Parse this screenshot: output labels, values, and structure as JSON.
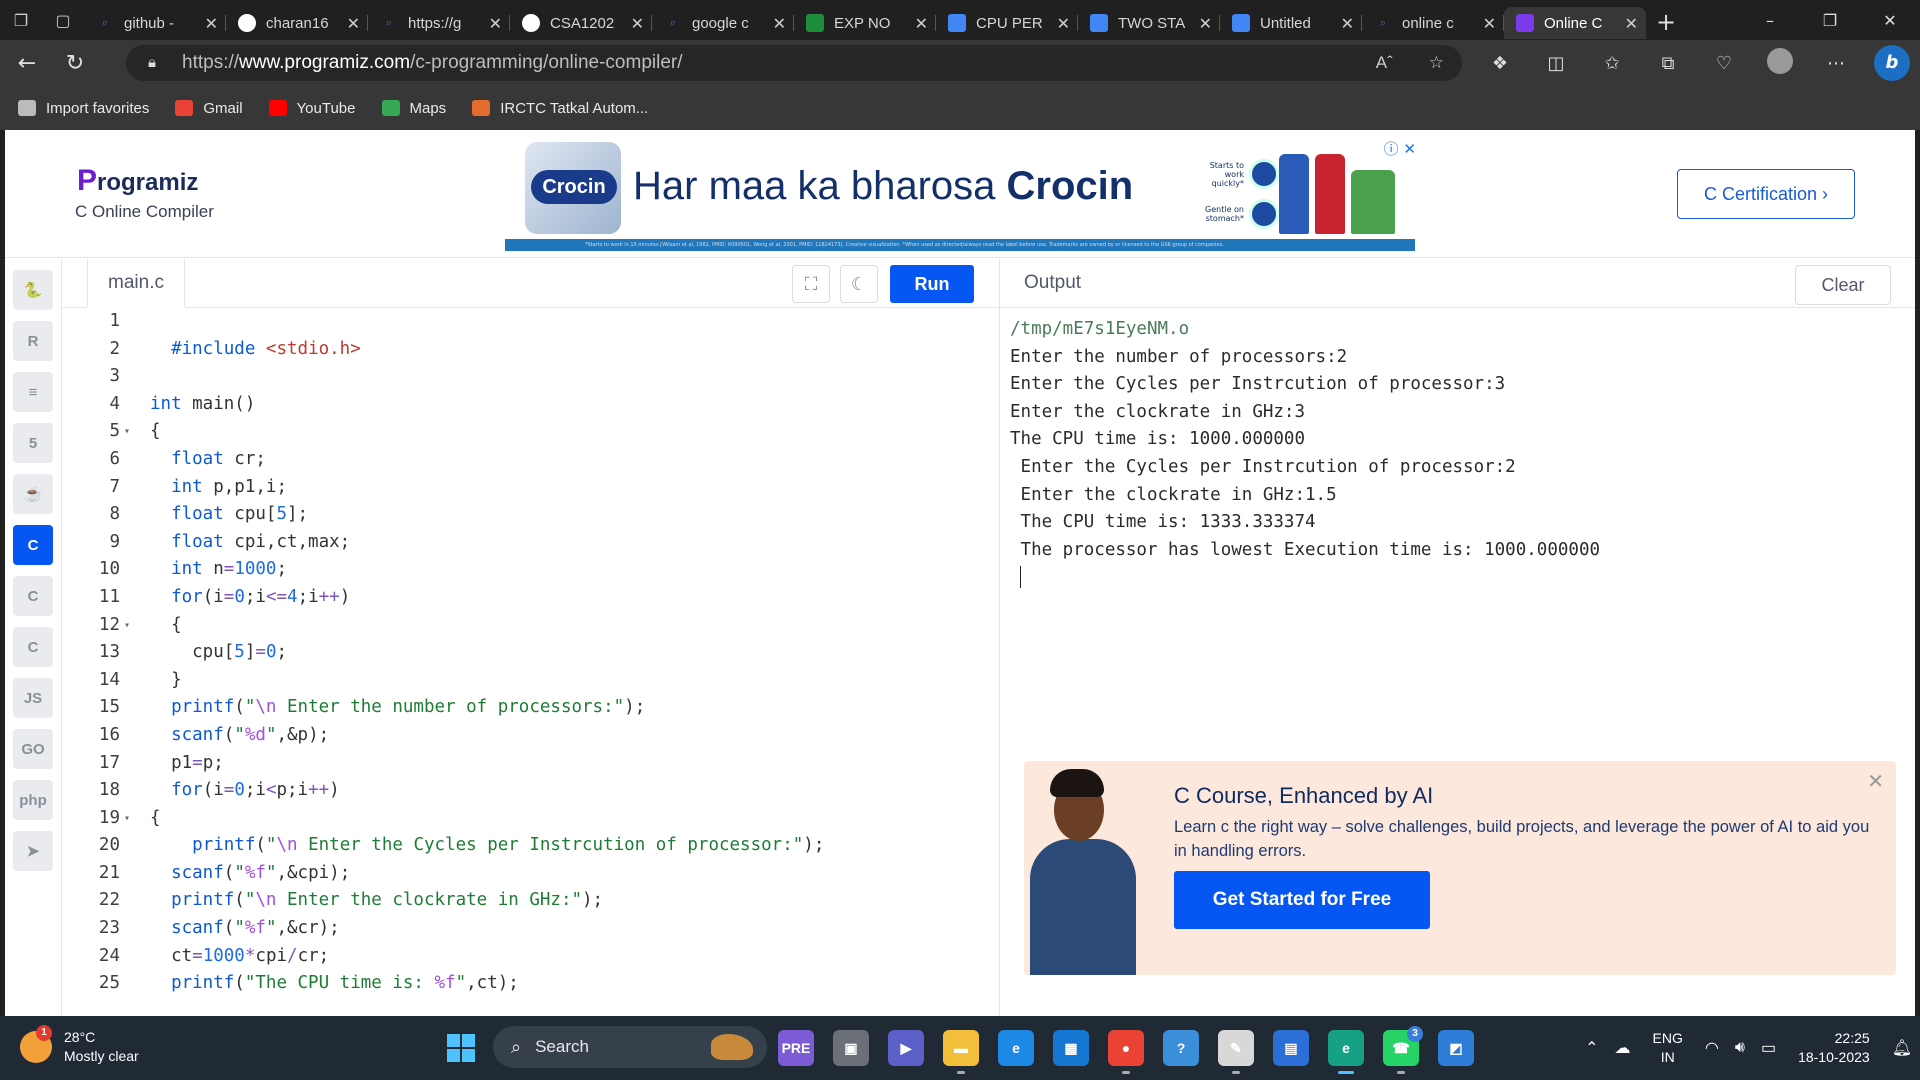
{
  "browser": {
    "tabs": [
      {
        "label": "github -",
        "icon": "search-icon",
        "color": "#3b6fd8"
      },
      {
        "label": "charan16",
        "icon": "github-icon",
        "color": "#ffffff"
      },
      {
        "label": "https://g",
        "icon": "search-icon",
        "color": "#3b6fd8"
      },
      {
        "label": "CSA1202",
        "icon": "github-icon",
        "color": "#ffffff"
      },
      {
        "label": "google c",
        "icon": "search-icon",
        "color": "#3b6fd8"
      },
      {
        "label": "EXP NO",
        "icon": "classroom-icon",
        "color": "#1e8e3e"
      },
      {
        "label": "CPU PER",
        "icon": "docs-icon",
        "color": "#4285f4"
      },
      {
        "label": "TWO STA",
        "icon": "docs-icon",
        "color": "#4285f4"
      },
      {
        "label": "Untitled",
        "icon": "docs-icon",
        "color": "#4285f4"
      },
      {
        "label": "online c",
        "icon": "search-icon",
        "color": "#3b6fd8"
      },
      {
        "label": "Online C",
        "icon": "programiz-icon",
        "color": "#7c3aed",
        "active": true
      }
    ],
    "url_prefix": "https://",
    "url_domain": "www.programiz.com",
    "url_path": "/c-programming/online-compiler/",
    "favorites": [
      {
        "label": "Import favorites",
        "icon": "import-icon",
        "color": "#bbbbbb"
      },
      {
        "label": "Gmail",
        "icon": "gmail-icon",
        "color": "#ea4335"
      },
      {
        "label": "YouTube",
        "icon": "youtube-icon",
        "color": "#ff0000"
      },
      {
        "label": "Maps",
        "icon": "maps-icon",
        "color": "#34a853"
      },
      {
        "label": "IRCTC Tatkal Autom...",
        "icon": "irctc-icon",
        "color": "#e46b2e"
      }
    ]
  },
  "site": {
    "logo": "rogramiz",
    "logo_initial": "P",
    "subtitle": "C Online Compiler",
    "certification_button": "C Certification ›"
  },
  "ad": {
    "brand_pack": "Crocin",
    "slogan_prefix": "Har maa ka bharosa ",
    "slogan_brand": "Crocin",
    "bubble_1": "Starts to work quickly*",
    "bubble_2": "Gentle on stomach*",
    "fine_print": "*Starts to work in 15 minutes [Wilsam et al, 1982, PMID: 6090501, Wong et al, 2001, PMID: 11824173]. Creative visualization. *When used as directed/always read the label before use. Trademarks are owned by or licensed to the GSK group of companies."
  },
  "editor": {
    "file_tab": "main.c",
    "run_button": "Run",
    "lines": [
      {
        "n": "1",
        "fold": "",
        "html": ""
      },
      {
        "n": "2",
        "fold": "",
        "html": "  <span class=\"pp\">#include</span> <span class=\"inc\">&lt;stdio.h&gt;</span>"
      },
      {
        "n": "3",
        "fold": "",
        "html": ""
      },
      {
        "n": "4",
        "fold": "",
        "html": "<span class=\"kw\">int</span> main()"
      },
      {
        "n": "5",
        "fold": "▾",
        "html": "{"
      },
      {
        "n": "6",
        "fold": "",
        "html": "  <span class=\"kw\">float</span> cr;"
      },
      {
        "n": "7",
        "fold": "",
        "html": "  <span class=\"kw\">int</span> p,p1,i;"
      },
      {
        "n": "8",
        "fold": "",
        "html": "  <span class=\"kw\">float</span> cpu[<span class=\"num\">5</span>];"
      },
      {
        "n": "9",
        "fold": "",
        "html": "  <span class=\"kw\">float</span> cpi,ct,max;"
      },
      {
        "n": "10",
        "fold": "",
        "html": "  <span class=\"kw\">int</span> n<span class=\"op\">=</span><span class=\"num\">1000</span>;"
      },
      {
        "n": "11",
        "fold": "",
        "html": "  <span class=\"kw\">for</span>(i<span class=\"op\">=</span><span class=\"num\">0</span>;i<span class=\"op\">&lt;=</span><span class=\"num\">4</span>;i<span class=\"op\">++</span>)"
      },
      {
        "n": "12",
        "fold": "▾",
        "html": "  {"
      },
      {
        "n": "13",
        "fold": "",
        "html": "    cpu[<span class=\"num\">5</span>]<span class=\"op\">=</span><span class=\"num\">0</span>;"
      },
      {
        "n": "14",
        "fold": "",
        "html": "  }"
      },
      {
        "n": "15",
        "fold": "",
        "html": "  <span class=\"kw\">printf</span>(<span class=\"str\">\"<span class=\"esc\">\\n</span> Enter the number of processors:\"</span>);"
      },
      {
        "n": "16",
        "fold": "",
        "html": "  <span class=\"kw\">scanf</span>(<span class=\"str\">\"<span class=\"esc\">%d</span>\"</span>,&amp;p);"
      },
      {
        "n": "17",
        "fold": "",
        "html": "  p1<span class=\"op\">=</span>p;"
      },
      {
        "n": "18",
        "fold": "",
        "html": "  <span class=\"kw\">for</span>(i<span class=\"op\">=</span><span class=\"num\">0</span>;i<span class=\"op\">&lt;</span>p;i<span class=\"op\">++</span>)"
      },
      {
        "n": "19",
        "fold": "▾",
        "html": "{"
      },
      {
        "n": "20",
        "fold": "",
        "html": "    <span class=\"kw\">printf</span>(<span class=\"str\">\"<span class=\"esc\">\\n</span> Enter the Cycles per Instrcution of processor:\"</span>);"
      },
      {
        "n": "21",
        "fold": "",
        "html": "  <span class=\"kw\">scanf</span>(<span class=\"str\">\"<span class=\"esc\">%f</span>\"</span>,&amp;cpi);"
      },
      {
        "n": "22",
        "fold": "",
        "html": "  <span class=\"kw\">printf</span>(<span class=\"str\">\"<span class=\"esc\">\\n</span> Enter the clockrate in GHz:\"</span>);"
      },
      {
        "n": "23",
        "fold": "",
        "html": "  <span class=\"kw\">scanf</span>(<span class=\"str\">\"<span class=\"esc\">%f</span>\"</span>,&amp;cr);"
      },
      {
        "n": "24",
        "fold": "",
        "html": "  ct<span class=\"op\">=</span><span class=\"num\">1000</span><span class=\"op\">*</span>cpi<span class=\"op\">/</span>cr;"
      },
      {
        "n": "25",
        "fold": "",
        "html": "  <span class=\"kw\">printf</span>(<span class=\"str\">\"The CPU time is: <span class=\"esc\">%f</span>\"</span>,ct);"
      }
    ]
  },
  "output": {
    "title": "Output",
    "clear_button": "Clear",
    "lines": [
      {
        "text": "/tmp/mE7s1EyeNM.o",
        "kind": "path"
      },
      {
        "text": "Enter the number of processors:2",
        "kind": ""
      },
      {
        "text": "Enter the Cycles per Instrcution of processor:3",
        "kind": ""
      },
      {
        "text": "Enter the clockrate in GHz:3",
        "kind": ""
      },
      {
        "text": "The CPU time is: 1000.000000",
        "kind": ""
      },
      {
        "text": " Enter the Cycles per Instrcution of processor:2",
        "kind": ""
      },
      {
        "text": " Enter the clockrate in GHz:1.5",
        "kind": ""
      },
      {
        "text": " The CPU time is: 1333.333374",
        "kind": ""
      },
      {
        "text": " The processor has lowest Execution time is: 1000.000000",
        "kind": ""
      }
    ]
  },
  "promo": {
    "title": "C Course, Enhanced by AI",
    "text": "Learn c the right way – solve challenges, build projects, and leverage the power of AI to aid you in handling errors.",
    "cta": "Get Started for Free"
  },
  "sidebar": [
    {
      "name": "python-icon",
      "glyph": "🐍",
      "active": false
    },
    {
      "name": "r-icon",
      "glyph": "R",
      "active": false
    },
    {
      "name": "sql-icon",
      "glyph": "≡",
      "active": false
    },
    {
      "name": "html-icon",
      "glyph": "5",
      "active": false
    },
    {
      "name": "java-icon",
      "glyph": "☕",
      "active": false
    },
    {
      "name": "c-icon",
      "glyph": "C",
      "active": true
    },
    {
      "name": "cpp-icon",
      "glyph": "C",
      "active": false
    },
    {
      "name": "csharp-icon",
      "glyph": "C",
      "active": false
    },
    {
      "name": "js-icon",
      "glyph": "JS",
      "active": false
    },
    {
      "name": "go-icon",
      "glyph": "GO",
      "active": false
    },
    {
      "name": "php-icon",
      "glyph": "php",
      "active": false
    },
    {
      "name": "swift-icon",
      "glyph": "➤",
      "active": false
    }
  ],
  "taskbar": {
    "temperature": "28°C",
    "weather": "Mostly clear",
    "weather_badge": "1",
    "search_placeholder": "Search",
    "apps": [
      {
        "name": "widgets-icon",
        "color": "#7b5cd6",
        "glyph": "PRE"
      },
      {
        "name": "task-view-icon",
        "color": "#6a6f78",
        "glyph": "▣"
      },
      {
        "name": "teams-icon",
        "color": "#5b5fc7",
        "glyph": "▶"
      },
      {
        "name": "file-explorer-icon",
        "color": "#f3bf3a",
        "glyph": "▬"
      },
      {
        "name": "edge-dev-icon",
        "color": "#1e88e5",
        "glyph": "e"
      },
      {
        "name": "store-icon",
        "color": "#1677d2",
        "glyph": "▦"
      },
      {
        "name": "chrome-icon",
        "color": "#ea4335",
        "glyph": "●"
      },
      {
        "name": "python-app-icon",
        "color": "#3b8ed8",
        "glyph": "?"
      },
      {
        "name": "notepad-icon",
        "color": "#d8d8d8",
        "glyph": "✎"
      },
      {
        "name": "ms-store-icon",
        "color": "#2b6fd6",
        "glyph": "▤"
      },
      {
        "name": "edge-icon",
        "color": "#16a085",
        "glyph": "e"
      },
      {
        "name": "whatsapp-icon",
        "color": "#25d366",
        "glyph": "☎"
      },
      {
        "name": "photos-icon",
        "color": "#2e7dd7",
        "glyph": "◩"
      }
    ],
    "whatsapp_badge": "3",
    "lang": "ENG",
    "region": "IN",
    "time": "22:25",
    "date": "18-10-2023"
  }
}
